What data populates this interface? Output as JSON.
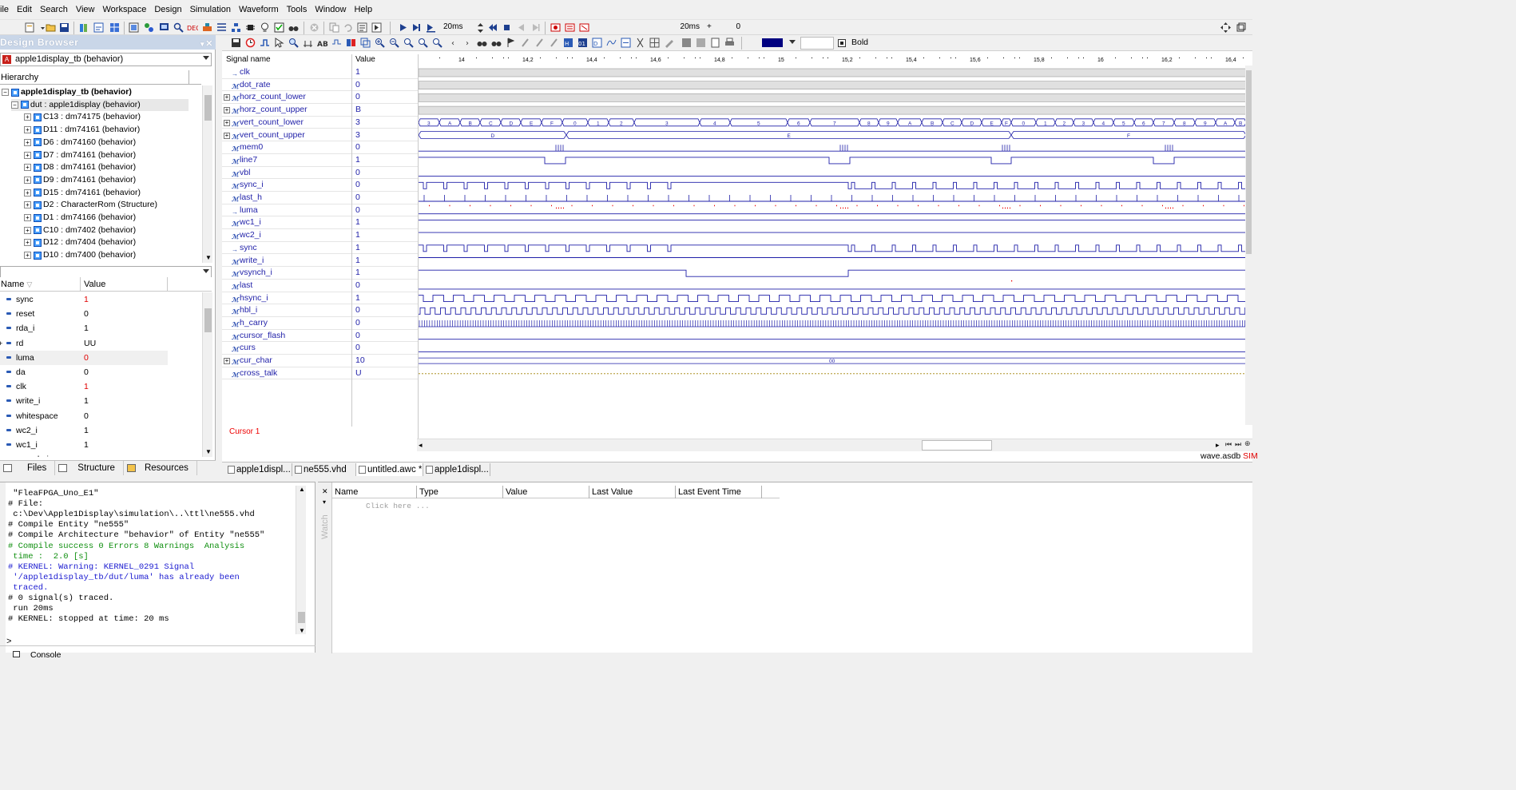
{
  "menu": [
    "ile",
    "Edit",
    "Search",
    "View",
    "Workspace",
    "Design",
    "Simulation",
    "Waveform",
    "Tools",
    "Window",
    "Help"
  ],
  "toolbar": {
    "sim_time": "20ms",
    "sim_time_2": "20ms",
    "step_plus": "+",
    "step_value": "0"
  },
  "design_browser": {
    "title": "Design Browser",
    "selected": "apple1display_tb (behavior)",
    "hierarchy_label": "Hierarchy",
    "tree": [
      {
        "label": "apple1display_tb (behavior)",
        "level": 0,
        "bold": true
      },
      {
        "label": "dut : apple1display (behavior)",
        "level": 1,
        "bold": false
      },
      {
        "label": "C13 : dm74175 (behavior)",
        "level": 2,
        "bold": false
      },
      {
        "label": "D11 : dm74161 (behavior)",
        "level": 2,
        "bold": false
      },
      {
        "label": "D6 : dm74160 (behavior)",
        "level": 2,
        "bold": false
      },
      {
        "label": "D7 : dm74161 (behavior)",
        "level": 2,
        "bold": false
      },
      {
        "label": "D8 : dm74161 (behavior)",
        "level": 2,
        "bold": false
      },
      {
        "label": "D9 : dm74161 (behavior)",
        "level": 2,
        "bold": false
      },
      {
        "label": "D15 : dm74161 (behavior)",
        "level": 2,
        "bold": false
      },
      {
        "label": "D2 : CharacterRom (Structure)",
        "level": 2,
        "bold": false
      },
      {
        "label": "D1 : dm74166 (behavior)",
        "level": 2,
        "bold": false
      },
      {
        "label": "C10 : dm7402 (behavior)",
        "level": 2,
        "bold": false
      },
      {
        "label": "D12 : dm7404 (behavior)",
        "level": 2,
        "bold": false
      },
      {
        "label": "D10 : dm7400 (behavior)",
        "level": 2,
        "bold": false
      }
    ],
    "objects_header": {
      "name": "Name",
      "value": "Value"
    },
    "objects": [
      {
        "name": "sync",
        "value": "1",
        "red": true
      },
      {
        "name": "reset",
        "value": "0",
        "red": false
      },
      {
        "name": "rda_i",
        "value": "1",
        "red": false
      },
      {
        "name": "rd",
        "value": "UU",
        "red": false
      },
      {
        "name": "luma",
        "value": "0",
        "red": true
      },
      {
        "name": "da",
        "value": "0",
        "red": false
      },
      {
        "name": "clk",
        "value": "1",
        "red": true
      },
      {
        "name": "write_i",
        "value": "1",
        "red": false
      },
      {
        "name": "whitespace",
        "value": "0",
        "red": false
      },
      {
        "name": "wc2_i",
        "value": "1",
        "red": false
      },
      {
        "name": "wc1_i",
        "value": "1",
        "red": false
      },
      {
        "name": "vsynch_i",
        "value": "",
        "red": false
      }
    ],
    "tabs": [
      "Files",
      "Structure",
      "Resources"
    ]
  },
  "wave": {
    "toolbar_style": "Bold",
    "accent_color": "#000080",
    "signal_header": "Signal name",
    "value_header": "Value",
    "cursor_label": "Cursor 1",
    "ticks": [
      "14",
      "14,2",
      "14,4",
      "14,6",
      "14,8",
      "15",
      "15,2",
      "15,4",
      "15,6",
      "15,8",
      "16",
      "16,2",
      "16,4"
    ],
    "signals": [
      {
        "name": "clk",
        "value": "1",
        "kind": "in",
        "expand": false
      },
      {
        "name": "dot_rate",
        "value": "0",
        "kind": "sig",
        "expand": false
      },
      {
        "name": "horz_count_lower",
        "value": "0",
        "kind": "sig",
        "expand": true
      },
      {
        "name": "horz_count_upper",
        "value": "B",
        "kind": "sig",
        "expand": true
      },
      {
        "name": "vert_count_lower",
        "value": "3",
        "kind": "sig",
        "expand": true
      },
      {
        "name": "vert_count_upper",
        "value": "3",
        "kind": "sig",
        "expand": true
      },
      {
        "name": "mem0",
        "value": "0",
        "kind": "sig",
        "expand": false
      },
      {
        "name": "line7",
        "value": "1",
        "kind": "sig",
        "expand": false
      },
      {
        "name": "vbl",
        "value": "0",
        "kind": "sig",
        "expand": false
      },
      {
        "name": "sync_i",
        "value": "0",
        "kind": "sig",
        "expand": false
      },
      {
        "name": "last_h",
        "value": "0",
        "kind": "sig",
        "expand": false
      },
      {
        "name": "luma",
        "value": "0",
        "kind": "out",
        "expand": false
      },
      {
        "name": "wc1_i",
        "value": "1",
        "kind": "sig",
        "expand": false
      },
      {
        "name": "wc2_i",
        "value": "1",
        "kind": "sig",
        "expand": false
      },
      {
        "name": "sync",
        "value": "1",
        "kind": "out",
        "expand": false
      },
      {
        "name": "write_i",
        "value": "1",
        "kind": "sig",
        "expand": false
      },
      {
        "name": "vsynch_i",
        "value": "1",
        "kind": "sig",
        "expand": false
      },
      {
        "name": "last",
        "value": "0",
        "kind": "sig",
        "expand": false
      },
      {
        "name": "hsync_i",
        "value": "1",
        "kind": "sig",
        "expand": false
      },
      {
        "name": "hbl_i",
        "value": "0",
        "kind": "sig",
        "expand": false
      },
      {
        "name": "h_carry",
        "value": "0",
        "kind": "sig",
        "expand": false
      },
      {
        "name": "cursor_flash",
        "value": "0",
        "kind": "sig",
        "expand": false
      },
      {
        "name": "curs",
        "value": "0",
        "kind": "sig",
        "expand": false
      },
      {
        "name": "cur_char",
        "value": "10",
        "kind": "sig",
        "expand": true
      },
      {
        "name": "cross_talk",
        "value": "U",
        "kind": "sig",
        "expand": false
      }
    ],
    "vert_count_lower_labels": [
      "3",
      "A",
      "B",
      "C",
      "D",
      "E",
      "F",
      "0",
      "1",
      "2",
      "3",
      "4",
      "5",
      "6",
      "7",
      "8",
      "9",
      "A",
      "B",
      "C",
      "D",
      "E",
      "F",
      "0",
      "1",
      "2",
      "3",
      "4",
      "5",
      "6",
      "7",
      "8",
      "9",
      "A",
      "B"
    ],
    "vert_count_upper_labels": [
      "D",
      "E",
      "F"
    ],
    "cur_char_label": "00"
  },
  "doc_tabs": [
    "apple1displ...",
    "ne555.vhd",
    "untitled.awc *",
    "apple1displ..."
  ],
  "status": {
    "file": "wave.asdb",
    "mode": "SIM"
  },
  "console": {
    "lines": [
      {
        "text": " \"FleaFPGA_Uno_E1\"",
        "cls": ""
      },
      {
        "text": "# File:",
        "cls": ""
      },
      {
        "text": " c:\\Dev\\Apple1Display\\simulation\\..\\ttl\\ne555.vhd",
        "cls": ""
      },
      {
        "text": "# Compile Entity \"ne555\"",
        "cls": ""
      },
      {
        "text": "# Compile Architecture \"behavior\" of Entity \"ne555\"",
        "cls": ""
      },
      {
        "text": "# Compile success 0 Errors 8 Warnings  Analysis",
        "cls": "green"
      },
      {
        "text": " time :  2.0 [s]",
        "cls": "green"
      },
      {
        "text": "# KERNEL: Warning: KERNEL_0291 Signal",
        "cls": "blue"
      },
      {
        "text": " '/apple1display_tb/dut/luma' has already been",
        "cls": "blue"
      },
      {
        "text": " traced.",
        "cls": "blue"
      },
      {
        "text": "# 0 signal(s) traced.",
        "cls": ""
      },
      {
        "text": " run 20ms",
        "cls": ""
      },
      {
        "text": "# KERNEL: stopped at time: 20 ms",
        "cls": ""
      }
    ],
    "prompt": ">",
    "tab": "Console",
    "side_label": "Console"
  },
  "watch": {
    "side_label": "Watch",
    "columns": [
      "Name",
      "Type",
      "Value",
      "Last Value",
      "Last Event Time"
    ],
    "placeholder": "Click here ..."
  }
}
